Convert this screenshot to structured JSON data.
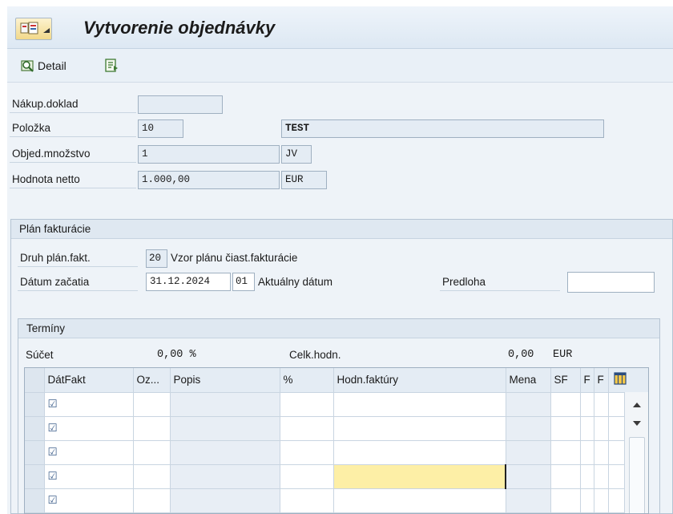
{
  "header": {
    "title": "Vytvorenie objednávky",
    "menu_icon": "sap-menu-icon"
  },
  "toolbar": {
    "detail_label": "Detail",
    "detail_icon": "magnifier-detail-icon",
    "doc_icon": "document-list-icon"
  },
  "item": {
    "nakup_label": "Nákup.doklad",
    "nakup_value": "",
    "polozka_label": "Položka",
    "polozka_value": "10",
    "polozka_text": "TEST",
    "mnozstvo_label": "Objed.množstvo",
    "mnozstvo_value": "1",
    "mnozstvo_unit": "JV",
    "netto_label": "Hodnota netto",
    "netto_value": "1.000,00",
    "netto_currency": "EUR"
  },
  "billing_plan": {
    "title": "Plán fakturácie",
    "druh_label": "Druh plán.fakt.",
    "druh_value": "20",
    "druh_text": "Vzor plánu čiast.fakturácie",
    "datum_label": "Dátum začatia",
    "datum_value": "31.12.2024",
    "datum_code": "01",
    "datum_text": "Aktuálny dátum",
    "predloha_label": "Predloha",
    "predloha_value": ""
  },
  "terms": {
    "title": "Termíny",
    "sucet_label": "Súčet",
    "sucet_value": "0,00 %",
    "celk_label": "Celk.hodn.",
    "celk_value": "0,00",
    "celk_currency": "EUR",
    "columns": [
      "DátFakt",
      "Oz...",
      "Popis",
      "%",
      "Hodn.faktúry",
      "Mena",
      "SF",
      "F",
      "F"
    ],
    "row_check": "☑"
  }
}
